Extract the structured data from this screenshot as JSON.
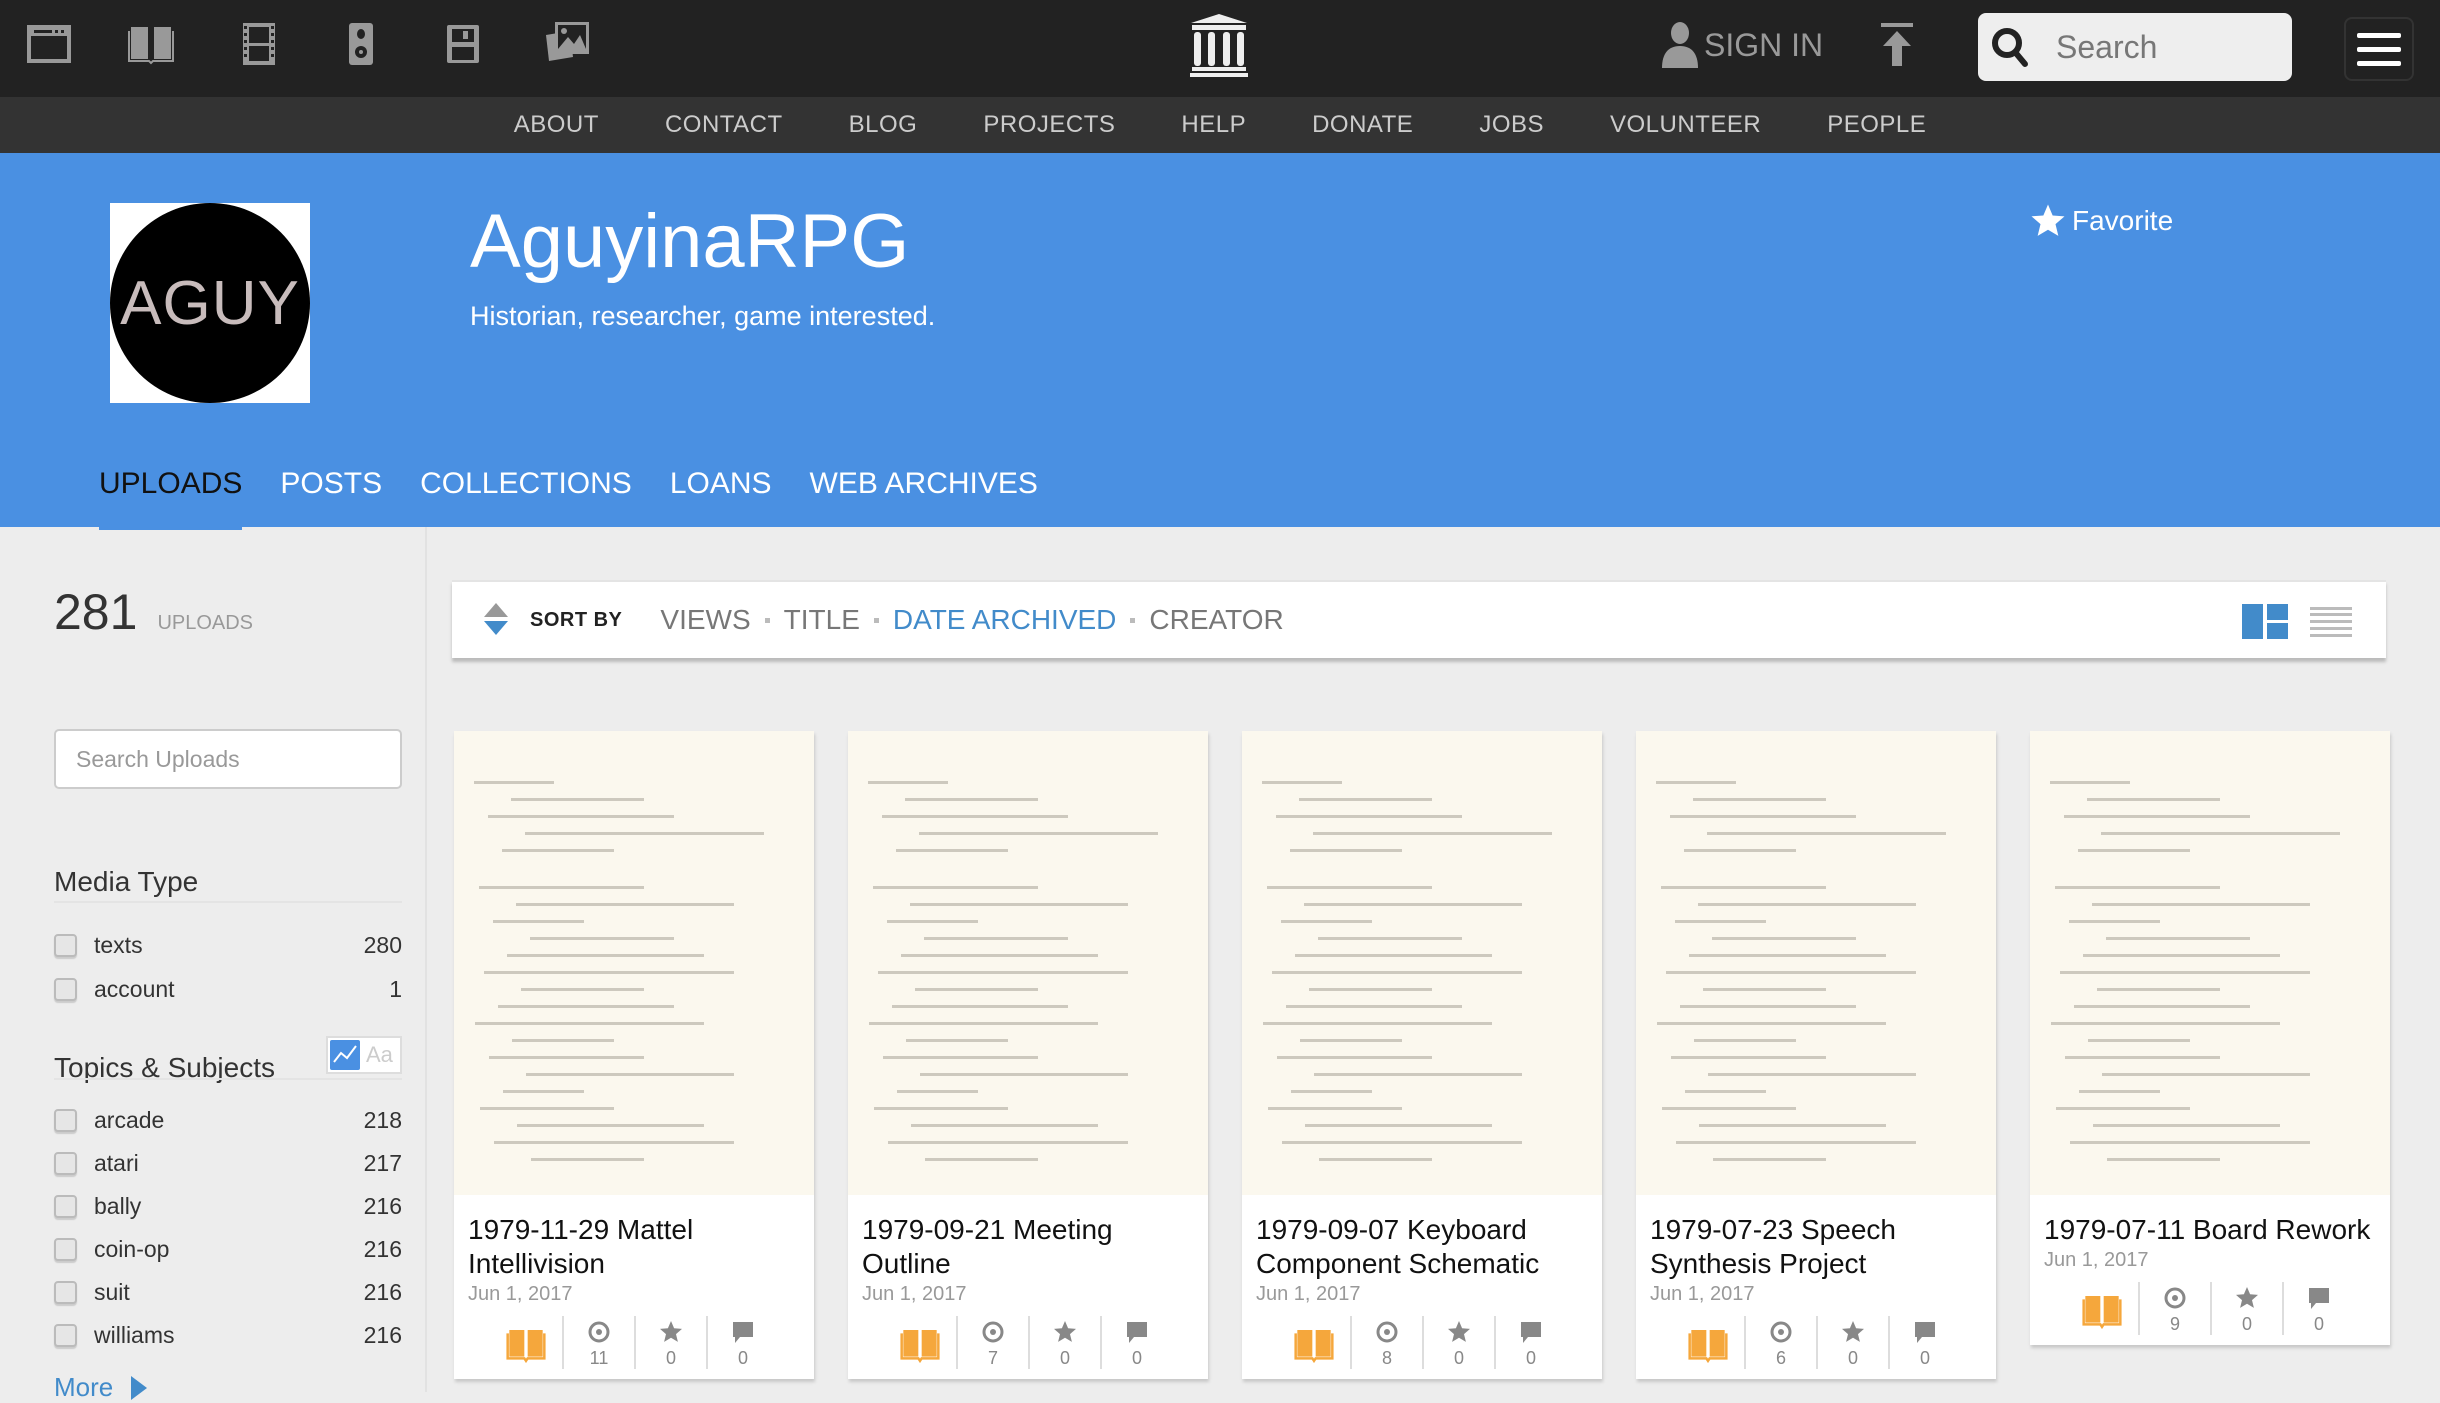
{
  "topbar": {
    "media_icons": [
      "web-icon",
      "texts-icon",
      "video-icon",
      "audio-icon",
      "software-icon",
      "images-icon"
    ],
    "logo": "archive-logo-icon",
    "sign_in": "SIGN IN",
    "search_placeholder": "Search"
  },
  "subnav": [
    "ABOUT",
    "CONTACT",
    "BLOG",
    "PROJECTS",
    "HELP",
    "DONATE",
    "JOBS",
    "VOLUNTEER",
    "PEOPLE"
  ],
  "profile": {
    "avatar_text": "AGUY",
    "name": "AguyinaRPG",
    "tagline": "Historian, researcher, game interested.",
    "favorite": "Favorite"
  },
  "tabs": [
    {
      "label": "UPLOADS",
      "active": true
    },
    {
      "label": "POSTS"
    },
    {
      "label": "COLLECTIONS"
    },
    {
      "label": "LOANS"
    },
    {
      "label": "WEB ARCHIVES"
    }
  ],
  "sidebar": {
    "count": "281",
    "count_label": "UPLOADS",
    "search_placeholder": "Search Uploads",
    "media_type": {
      "heading": "Media Type",
      "items": [
        {
          "label": "texts",
          "count": "280"
        },
        {
          "label": "account",
          "count": "1"
        }
      ]
    },
    "topics": {
      "heading": "Topics & Subjects",
      "toggle_text": "Aa",
      "items": [
        {
          "label": "arcade",
          "count": "218"
        },
        {
          "label": "atari",
          "count": "217"
        },
        {
          "label": "bally",
          "count": "216"
        },
        {
          "label": "coin-op",
          "count": "216"
        },
        {
          "label": "suit",
          "count": "216"
        },
        {
          "label": "williams",
          "count": "216"
        }
      ],
      "more": "More"
    }
  },
  "sortbar": {
    "label": "SORT BY",
    "options": [
      {
        "label": "VIEWS"
      },
      {
        "label": "TITLE"
      },
      {
        "label": "DATE ARCHIVED",
        "active": true
      },
      {
        "label": "CREATOR"
      }
    ]
  },
  "items": [
    {
      "title_1": "1979-11-29 Mattel",
      "title_2": "Intellivision",
      "date": "Jun 1, 2017",
      "views": "11",
      "favorites": "0",
      "reviews": "0"
    },
    {
      "title_1": "1979-09-21 Meeting",
      "title_2": "Outline",
      "date": "Jun 1, 2017",
      "views": "7",
      "favorites": "0",
      "reviews": "0"
    },
    {
      "title_1": "1979-09-07 Keyboard",
      "title_2": "Component Schematic",
      "date": "Jun 1, 2017",
      "views": "8",
      "favorites": "0",
      "reviews": "0"
    },
    {
      "title_1": "1979-07-23 Speech",
      "title_2": "Synthesis Project",
      "date": "Jun 1, 2017",
      "views": "6",
      "favorites": "0",
      "reviews": "0"
    },
    {
      "title_1": "1979-07-11 Board Rework",
      "title_2": "",
      "date": "Jun 1, 2017",
      "views": "9",
      "favorites": "0",
      "reviews": "0"
    }
  ],
  "colors": {
    "brand_blue": "#4a90e2",
    "link_blue": "#428bca",
    "texts_orange": "#f5a73c",
    "topbar": "#222222",
    "subnav": "#333333"
  }
}
